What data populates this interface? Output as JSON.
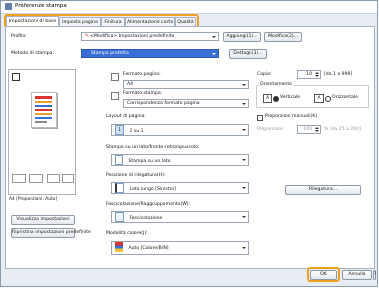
{
  "window": {
    "title": "Preferenze stampa"
  },
  "tabs": [
    {
      "label": "Impostazioni di base"
    },
    {
      "label": "Imposta pagina"
    },
    {
      "label": "Finitura"
    },
    {
      "label": "Alimentazione carta"
    },
    {
      "label": "Qualità"
    }
  ],
  "profile": {
    "label": "Profilo:",
    "value": "<Modifica> Impostazioni predefinite",
    "add": "Aggiungi(1)...",
    "edit": "Modifica(2)..."
  },
  "output": {
    "label": "Metodo di stampa:",
    "value": "Stampa protetta",
    "details": "Dettagli(3)..."
  },
  "preview": {
    "caption": "A4 [Proporzioni: Auto]",
    "view_settings": "Visualizza impostazioni",
    "restore": "Ripristina impostazioni predefinite"
  },
  "page_size": {
    "label": "Formato pagina:",
    "value": "A4"
  },
  "output_size": {
    "label": "Formato stampa:",
    "value": "Corrispondenza formato pagina"
  },
  "copies": {
    "label": "Copie:",
    "value": "10",
    "range": "[da 1 a 999]"
  },
  "orientation": {
    "label": "Orientamento",
    "portrait": "Verticale",
    "landscape": "Orizzontale"
  },
  "layout": {
    "label": "Layout di pagina:",
    "value": "1 su 1"
  },
  "manual_scaling": {
    "label": "Proporzioni manuali(K)",
    "field_label": "Proporzioni:",
    "value": "100",
    "range": "% [da 25 a 200]"
  },
  "duplex": {
    "label": "Stampa su un lato/fronte-retro/opuscolo:",
    "value": "Stampa su un lato"
  },
  "binding": {
    "label": "Posizione di rilegatura(H):",
    "value": "Lato lungo [Sinistro]",
    "button": "Rilegatura..."
  },
  "finishing": {
    "label": "Fascicolazione/Raggruppamento(W):",
    "value": "Fascicolazione"
  },
  "color_mode": {
    "label": "Modalità colore(J):",
    "value": "Auto [Colore/B/N]"
  },
  "footer": {
    "ok": "OK",
    "cancel": "Annulla",
    "help": "?"
  }
}
